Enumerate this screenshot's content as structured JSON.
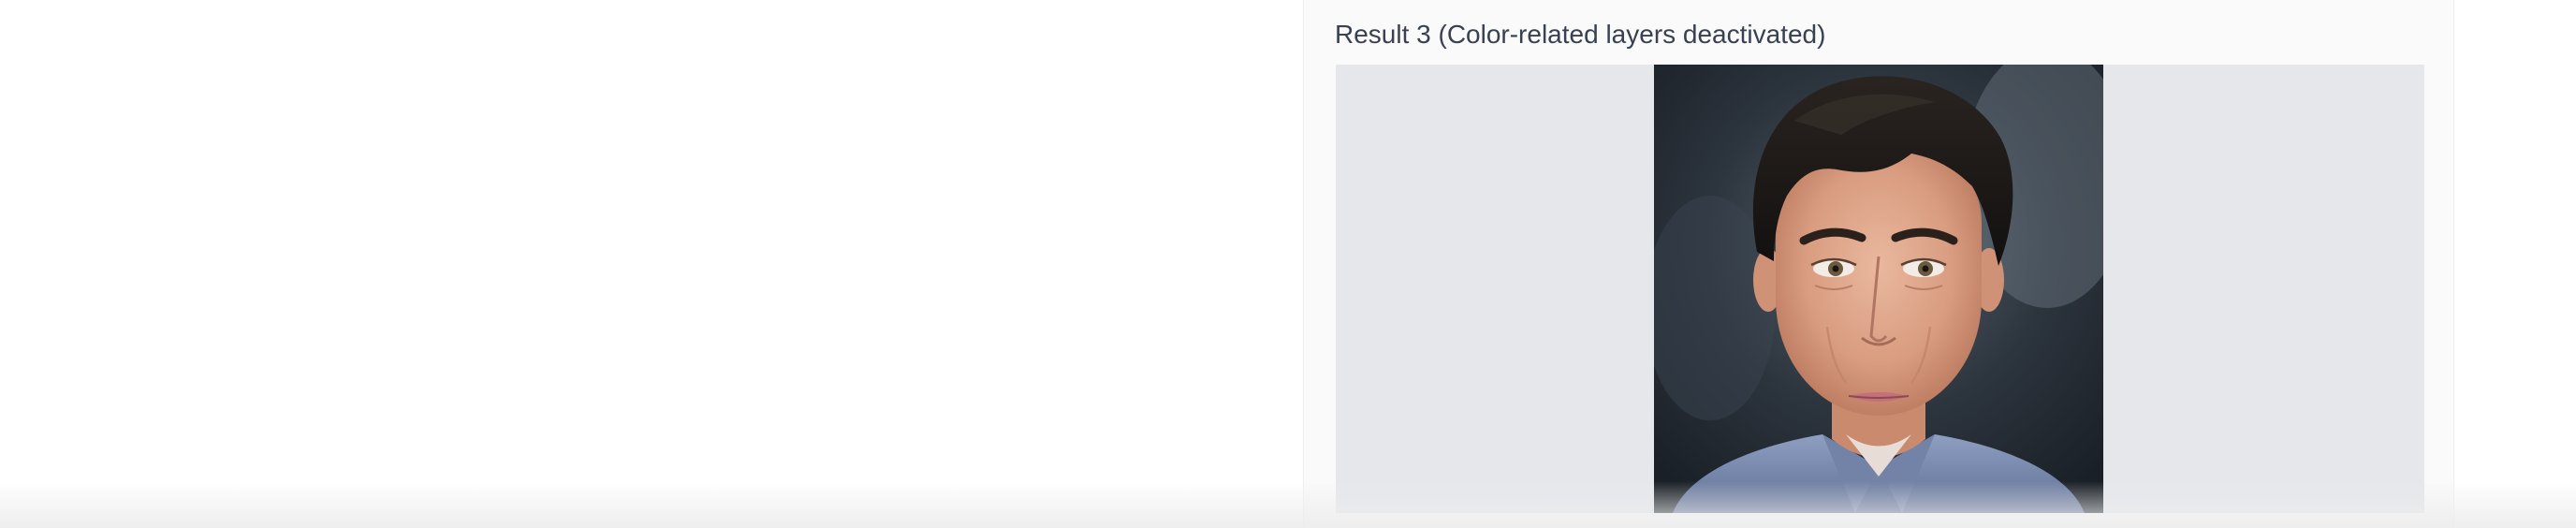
{
  "result": {
    "label": "Result 3 (Color-related layers deactivated)"
  },
  "image": {
    "icon": "portrait-image",
    "background_color": "#e5e7eb"
  }
}
